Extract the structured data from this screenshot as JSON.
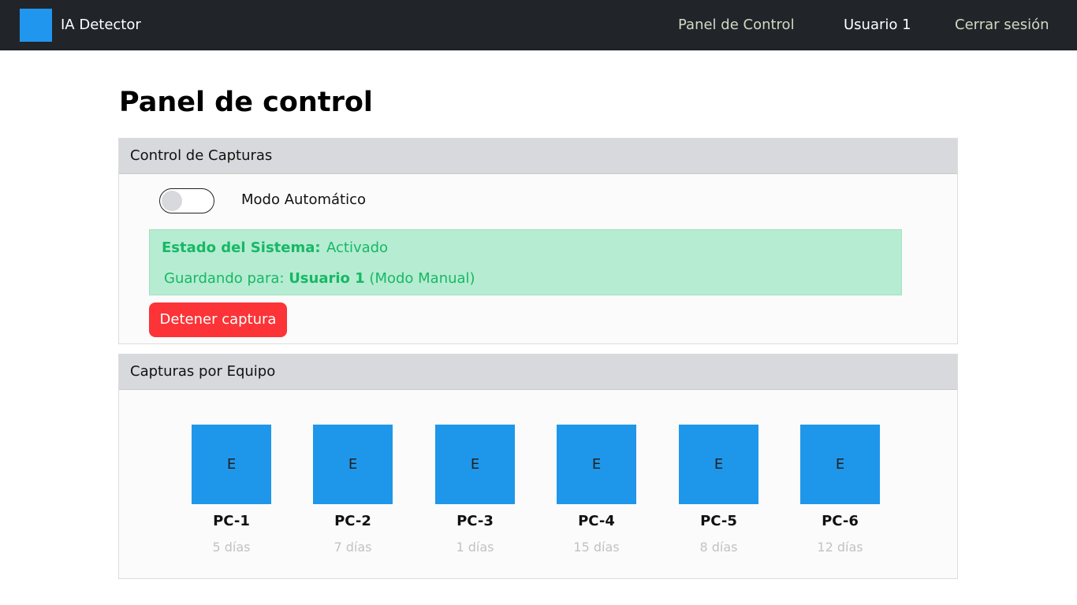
{
  "navbar": {
    "brand": "IA Detector",
    "links": {
      "panel": "Panel de Control",
      "user": "Usuario 1",
      "logout": "Cerrar sesión"
    }
  },
  "page": {
    "title": "Panel de control"
  },
  "capture_control": {
    "header": "Control de Capturas",
    "toggle": {
      "label": "Modo Automático",
      "on": false
    },
    "status": {
      "key": "Estado del Sistema:",
      "value": "Activado",
      "saving_prefix": "Guardando para:",
      "saving_user": "Usuario 1",
      "saving_mode": "(Modo Manual)"
    },
    "stop_button": "Detener captura"
  },
  "captures_by_device": {
    "header": "Capturas por Equipo",
    "devices": [
      {
        "letter": "E",
        "name": "PC-1",
        "days": "5 días"
      },
      {
        "letter": "E",
        "name": "PC-2",
        "days": "7 días"
      },
      {
        "letter": "E",
        "name": "PC-3",
        "days": "1 días"
      },
      {
        "letter": "E",
        "name": "PC-4",
        "days": "15 días"
      },
      {
        "letter": "E",
        "name": "PC-5",
        "days": "8 días"
      },
      {
        "letter": "E",
        "name": "PC-6",
        "days": "12 días"
      }
    ]
  },
  "colors": {
    "navbar_bg": "#212529",
    "accent_blue": "#2196ef",
    "status_bg": "#b6ecd2",
    "status_text": "#17b865",
    "danger": "#fc3337"
  }
}
